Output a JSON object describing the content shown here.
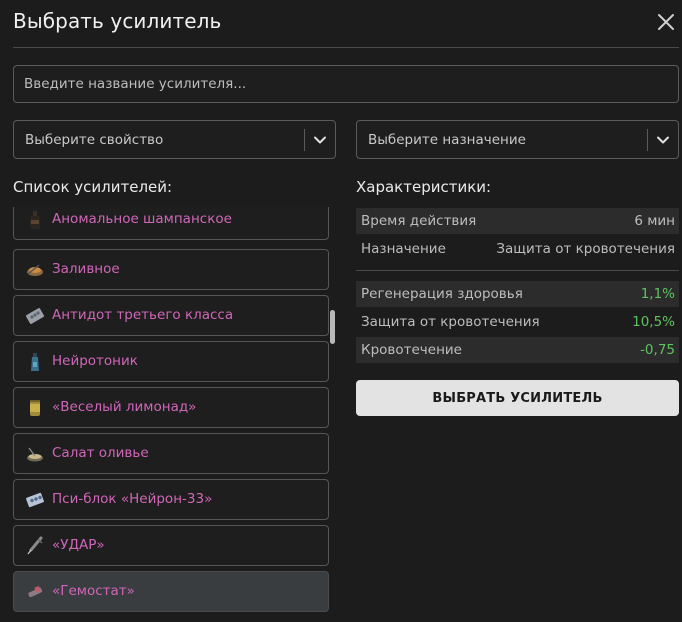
{
  "dialog": {
    "title": "Выбрать усилитель",
    "close_icon": "close-icon"
  },
  "search": {
    "placeholder": "Введите название усилителя..."
  },
  "filters": {
    "property": {
      "value": "Выберите свойство",
      "icon": "chevron-down-icon"
    },
    "purpose": {
      "value": "Выберите назначение",
      "icon": "chevron-down-icon"
    }
  },
  "list": {
    "heading": "Список усилителей:",
    "items": [
      {
        "label": "Аномальное шампанское",
        "icon": "bottle-icon"
      },
      {
        "label": "Заливное",
        "icon": "aspic-icon"
      },
      {
        "label": "Антидот третьего класса",
        "icon": "pill-blister-icon"
      },
      {
        "label": "Нейротоник",
        "icon": "vial-icon"
      },
      {
        "label": "«Веселый лимонад»",
        "icon": "can-icon"
      },
      {
        "label": "Салат оливье",
        "icon": "salad-icon"
      },
      {
        "label": "Пси-блок «Нейрон-33»",
        "icon": "pill-blister-icon"
      },
      {
        "label": "«УДАР»",
        "icon": "syringe-icon"
      },
      {
        "label": "«Гемостат»",
        "icon": "injector-icon",
        "selected": true
      }
    ]
  },
  "characteristics": {
    "heading": "Характеристики:",
    "meta": [
      {
        "key": "Время действия",
        "value": "6 мин"
      },
      {
        "key": "Назначение",
        "value": "Защита от кровотечения"
      }
    ],
    "stats": [
      {
        "key": "Регенерация здоровья",
        "value": "1,1%",
        "positive": true
      },
      {
        "key": "Защита от кровотечения",
        "value": "10,5%",
        "positive": true
      },
      {
        "key": "Кровотечение",
        "value": "-0,75",
        "positive": true
      }
    ]
  },
  "actions": {
    "select_label": "ВЫБРАТЬ УСИЛИТЕЛЬ"
  },
  "colors": {
    "background": "#1c1c1c",
    "item_label": "#d066b8",
    "positive_value": "#5ec35e",
    "button_bg": "#e3e3e3",
    "selected_item_bg": "#3a3d40"
  }
}
